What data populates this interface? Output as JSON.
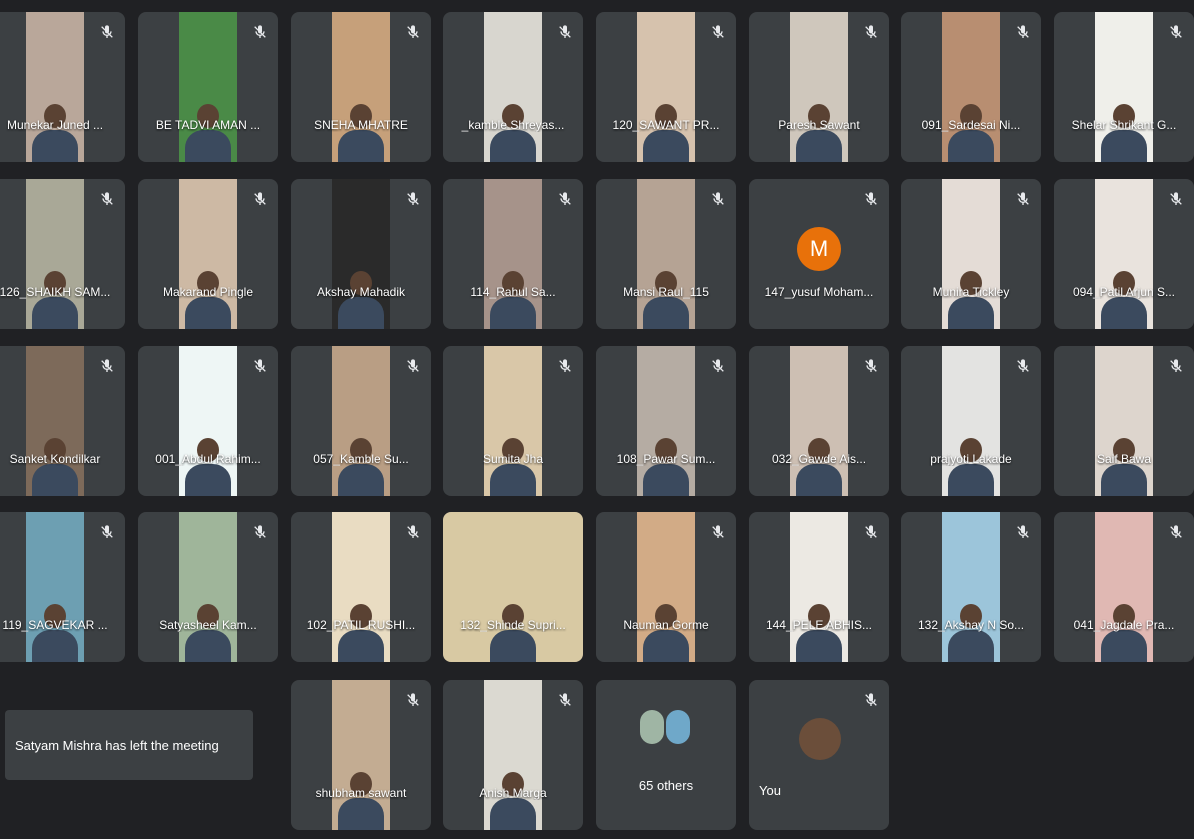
{
  "meeting": {
    "toast": "Satyam Mishra has left the meeting",
    "others_count_label": "65 others",
    "self_label": "You",
    "icons": {
      "mic": "mic-off-icon"
    },
    "colors": {
      "background": "#202124",
      "tile": "#3c4043",
      "avatar_m": "#e8710a"
    },
    "tiles": [
      {
        "name": "Munekar Juned ...",
        "video": "#b9a79a",
        "muted": true
      },
      {
        "name": "BE TADVI AMAN ...",
        "video": "#4a8a47",
        "muted": true
      },
      {
        "name": "SNEHA MHATRE",
        "video": "#c6a07a",
        "muted": true
      },
      {
        "name": "_kamble Shreyas...",
        "video": "#d8d6cf",
        "muted": true
      },
      {
        "name": "120_SAWANT PR...",
        "video": "#d6c2ad",
        "muted": true
      },
      {
        "name": "Paresh Sawant",
        "video": "#cfc7bc",
        "muted": true
      },
      {
        "name": "091_Sardesai Ni...",
        "video": "#b88e71",
        "muted": true
      },
      {
        "name": "Shelar Shrikant G...",
        "video": "#efefea",
        "muted": true
      },
      {
        "name": "126_SHAIKH SAM...",
        "video": "#a9a897",
        "muted": true
      },
      {
        "name": "Makarand Pingle",
        "video": "#cdb9a4",
        "muted": true
      },
      {
        "name": "Akshay Mahadik",
        "video": "#2a2a2a",
        "muted": true
      },
      {
        "name": "114_Rahul Sa...",
        "video": "#a6938a",
        "muted": true
      },
      {
        "name": "Mansi Raul_115",
        "video": "#b5a394",
        "muted": true
      },
      {
        "name": "147_yusuf Moham...",
        "avatar": "M",
        "muted": true
      },
      {
        "name": "Munira Tickley",
        "video": "#e4dcd6",
        "muted": true
      },
      {
        "name": "094_Patil Arjun S...",
        "video": "#e9e3dd",
        "muted": true
      },
      {
        "name": "Sanket Kondilkar",
        "video": "#7d6a5a",
        "muted": true
      },
      {
        "name": "001_Abdul Rahim...",
        "video": "#eef6f5",
        "muted": true
      },
      {
        "name": "057_Kamble Su...",
        "video": "#b99e84",
        "muted": true
      },
      {
        "name": "Sumita Jha",
        "video": "#d9c7a8",
        "muted": true
      },
      {
        "name": "108_Pawar Sum...",
        "video": "#b5aca3",
        "muted": true
      },
      {
        "name": "032_Gawde Ais...",
        "video": "#cdbfb3",
        "muted": true
      },
      {
        "name": "prajyoti Lakade",
        "video": "#e3e3e1",
        "muted": true
      },
      {
        "name": "Saif Bawa",
        "video": "#ddd5cd",
        "muted": true
      },
      {
        "name": "119_SAGVEKAR ...",
        "video": "#6d9fb2",
        "muted": true
      },
      {
        "name": "Satyasheel Kam...",
        "video": "#9fb59a",
        "muted": true
      },
      {
        "name": "102_PATIL RUSHI...",
        "video": "#e9dcc2",
        "muted": true
      },
      {
        "name": "132_Shinde Supri...",
        "video": "#d8c9a3",
        "muted": false,
        "wide": true
      },
      {
        "name": "Nauman Gorme",
        "video": "#d2ab86",
        "muted": true
      },
      {
        "name": "144_PELE ABHIS...",
        "video": "#ece9e3",
        "muted": true
      },
      {
        "name": "132_Akshay N So...",
        "video": "#9cc5da",
        "muted": true
      },
      {
        "name": "041_Jagdale Pra...",
        "video": "#e0b8b3",
        "muted": true
      },
      {
        "name": "shubham sawant",
        "video": "#c3ac92",
        "muted": true
      },
      {
        "name": "Anish Marga",
        "video": "#dbd9d1",
        "muted": true
      }
    ]
  }
}
